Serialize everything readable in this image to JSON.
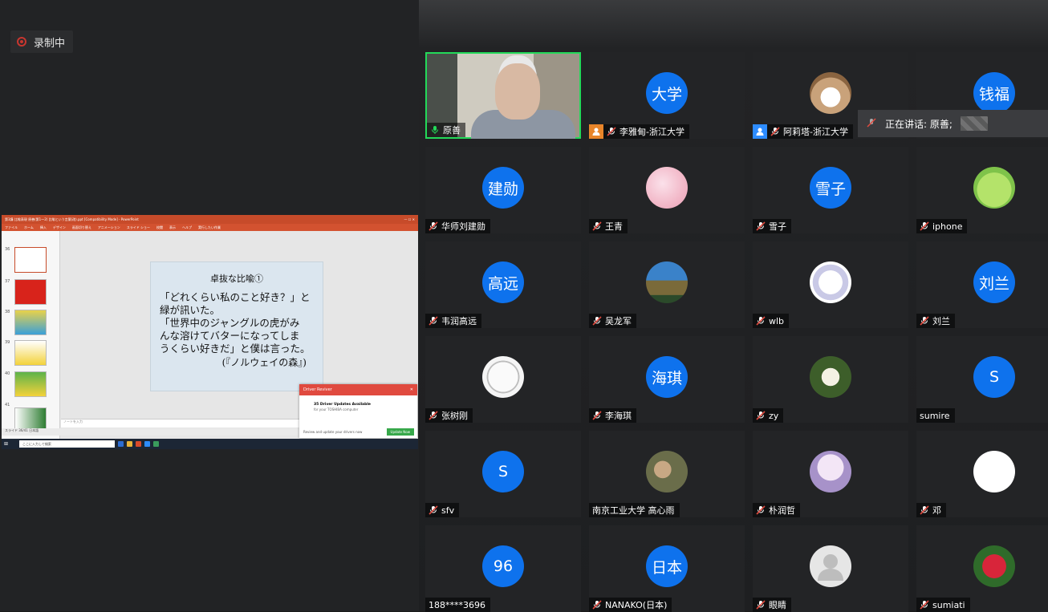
{
  "recording": {
    "label": "录制中"
  },
  "speaking": {
    "label": "正在讲话: 原善;"
  },
  "powerpoint": {
    "window_title": "第3講 比喩表現 原善(第1〜2) 比喩という言葉(改).ppt [Compatibility Mode] - PowerPoint",
    "ribbon": [
      "ファイル",
      "ホーム",
      "挿入",
      "デザイン",
      "画面切り替え",
      "アニメーション",
      "スライド ショー",
      "校閲",
      "表示",
      "ヘルプ",
      "実行したい作業"
    ],
    "thumb_numbers": [
      "36",
      "37",
      "38",
      "39",
      "40",
      "41"
    ],
    "slide": {
      "heading": "卓抜な比喩①",
      "body": "「どれくらい私のこと好き？」と\n緑が訊いた。\n「世界中のジャングルの虎がみ\nんな溶けてバターになってしま\nうくらい好きだ」と僕は言った。",
      "source": "(『ノルウェイの森』)"
    },
    "notes_placeholder": "ノートを入力",
    "status_text": "スライド 36/41   日本語",
    "taskbar_search": "ここに入力して検索",
    "driver_popup": {
      "title": "Driver Reviver",
      "line1": "35 Driver Updates Available",
      "line2": "for your TOSHIBA computer",
      "footer": "Review and update your drivers now",
      "button": "Update Now"
    }
  },
  "participants": [
    {
      "name": "原善",
      "type": "video",
      "mic": "on"
    },
    {
      "name": "李雅甸-浙江大学",
      "avatar_text": "大学",
      "mic": "muted",
      "badge": "orange"
    },
    {
      "name": "阿莉塔-浙江大学",
      "avatar_image": "cat-photo",
      "mic": "muted",
      "badge": "blue"
    },
    {
      "name": "",
      "avatar_text": "钱福",
      "mic": "none"
    },
    {
      "name": "华师刘建勋",
      "avatar_text": "建勋",
      "mic": "muted"
    },
    {
      "name": "王青",
      "avatar_image": "pink-flowers",
      "mic": "muted"
    },
    {
      "name": "雪子",
      "avatar_text": "雪子",
      "mic": "muted"
    },
    {
      "name": "iphone",
      "avatar_image": "green-frog",
      "mic": "muted"
    },
    {
      "name": "韦润高远",
      "avatar_text": "高远",
      "mic": "muted"
    },
    {
      "name": "吴龙军",
      "avatar_image": "lighthouse",
      "mic": "muted"
    },
    {
      "name": "wlb",
      "avatar_image": "sketch-drawing",
      "mic": "muted"
    },
    {
      "name": "刘兰",
      "avatar_text": "刘兰",
      "mic": "muted"
    },
    {
      "name": "张树刚",
      "avatar_image": "anime-sketch",
      "mic": "muted"
    },
    {
      "name": "李海琪",
      "avatar_text": "海琪",
      "mic": "muted"
    },
    {
      "name": "zy",
      "avatar_image": "white-flowers",
      "mic": "muted"
    },
    {
      "name": "sumire",
      "avatar_text": "S",
      "mic": "none"
    },
    {
      "name": "sfv",
      "avatar_text": "S",
      "mic": "muted"
    },
    {
      "name": "南京工业大学 高心雨",
      "avatar_image": "two-people",
      "mic": "none"
    },
    {
      "name": "朴润哲",
      "avatar_image": "anime-girl",
      "mic": "muted"
    },
    {
      "name": "邓",
      "avatar_image": "calligraphy",
      "mic": "muted"
    },
    {
      "name": "188****3696",
      "avatar_text": "96",
      "mic": "none"
    },
    {
      "name": "NANAKO(日本)",
      "avatar_text": "日本",
      "mic": "muted"
    },
    {
      "name": "眼睛",
      "avatar_image": "default-person",
      "mic": "muted"
    },
    {
      "name": "sumiati",
      "avatar_image": "red-flower",
      "mic": "muted"
    }
  ]
}
